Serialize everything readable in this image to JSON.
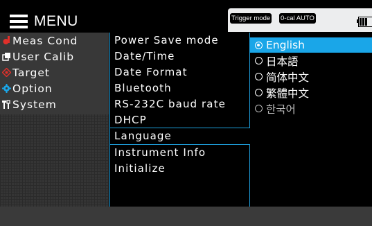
{
  "header": {
    "menu_label": "MENU"
  },
  "status": {
    "trigger_mode": "Trigger mode",
    "cal_mode": "0-cal AUTO"
  },
  "sidebar": {
    "items": [
      {
        "label": "Meas Cond",
        "icon": "meas-cond-icon",
        "color": "#e0302a"
      },
      {
        "label": "User Calib",
        "icon": "user-calib-icon",
        "color": "#ffffff"
      },
      {
        "label": "Target",
        "icon": "target-icon",
        "color": "#e0302a"
      },
      {
        "label": "Option",
        "icon": "gear-icon",
        "color": "#1aa6e8"
      },
      {
        "label": "System",
        "icon": "tools-icon",
        "color": "#ffffff"
      }
    ]
  },
  "submenu": {
    "items": [
      "Power Save mode",
      "Date/Time",
      "Date Format",
      "Bluetooth",
      "RS-232C baud rate",
      "DHCP"
    ],
    "selected": "Language",
    "items2": [
      "Instrument Info",
      "Initialize"
    ]
  },
  "options": {
    "items": [
      {
        "label": "English",
        "selected": true
      },
      {
        "label": "日本語",
        "selected": false
      },
      {
        "label": "简体中文",
        "selected": false
      },
      {
        "label": "繁體中文",
        "selected": false
      },
      {
        "label": "한국어",
        "selected": false
      }
    ]
  },
  "colors": {
    "accent": "#1aa6e8",
    "highlight_red": "#e0302a"
  }
}
